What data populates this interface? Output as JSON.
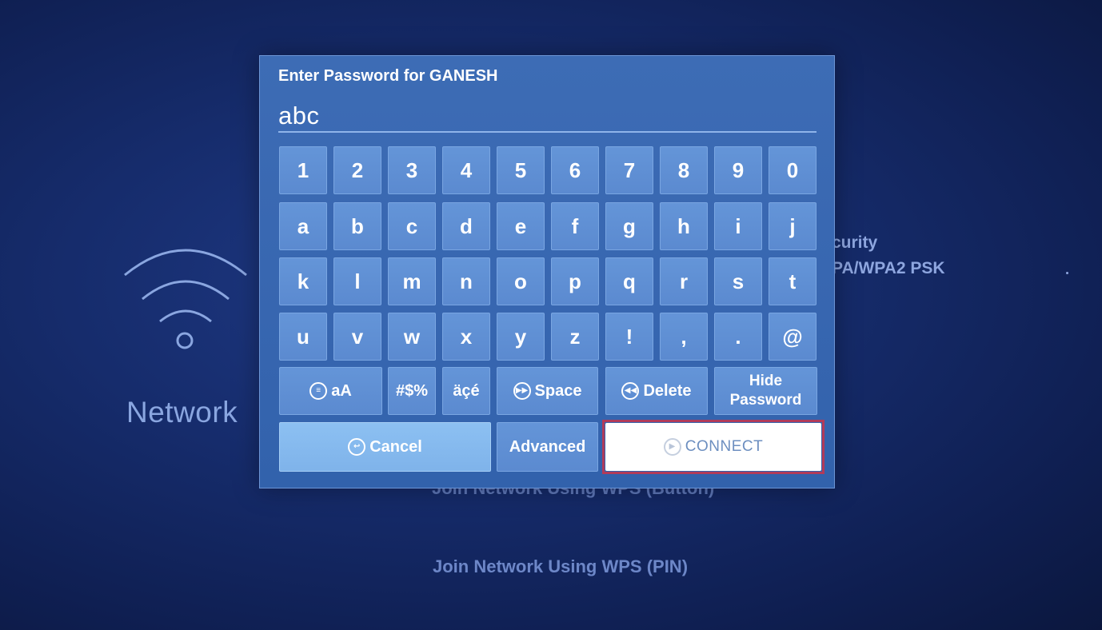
{
  "background": {
    "network_label": "Network",
    "security_title": "curity",
    "security_value": "PA/WPA2 PSK",
    "menu_wps_button": "Join Network Using WPS (Button)",
    "menu_wps_pin": "Join Network Using WPS (PIN)"
  },
  "dialog": {
    "title": "Enter Password for GANESH",
    "password_value": "abc",
    "rows": [
      [
        "1",
        "2",
        "3",
        "4",
        "5",
        "6",
        "7",
        "8",
        "9",
        "0"
      ],
      [
        "a",
        "b",
        "c",
        "d",
        "e",
        "f",
        "g",
        "h",
        "i",
        "j"
      ],
      [
        "k",
        "l",
        "m",
        "n",
        "o",
        "p",
        "q",
        "r",
        "s",
        "t"
      ],
      [
        "u",
        "v",
        "w",
        "x",
        "y",
        "z",
        "!",
        ",",
        ".",
        "@"
      ]
    ],
    "function_keys": {
      "case_toggle": "aA",
      "symbols": "#$%",
      "accents": "äçé",
      "space": "Space",
      "delete": "Delete",
      "hide_password_line1": "Hide",
      "hide_password_line2": "Password"
    },
    "actions": {
      "cancel": "Cancel",
      "advanced": "Advanced",
      "connect": "CONNECT"
    }
  },
  "icons": {
    "wifi": "wifi-icon",
    "menu": "menu-icon",
    "fast_forward": "fast-forward-icon",
    "rewind": "rewind-icon",
    "back": "back-icon",
    "play_pause": "play-pause-icon"
  },
  "colors": {
    "dialog_bg": "#3766b0",
    "key_bg": "#5b8ad0",
    "cancel_bg": "#7fb3ea",
    "connect_bg": "#ffffff",
    "focus_frame": "#b13b5a"
  }
}
